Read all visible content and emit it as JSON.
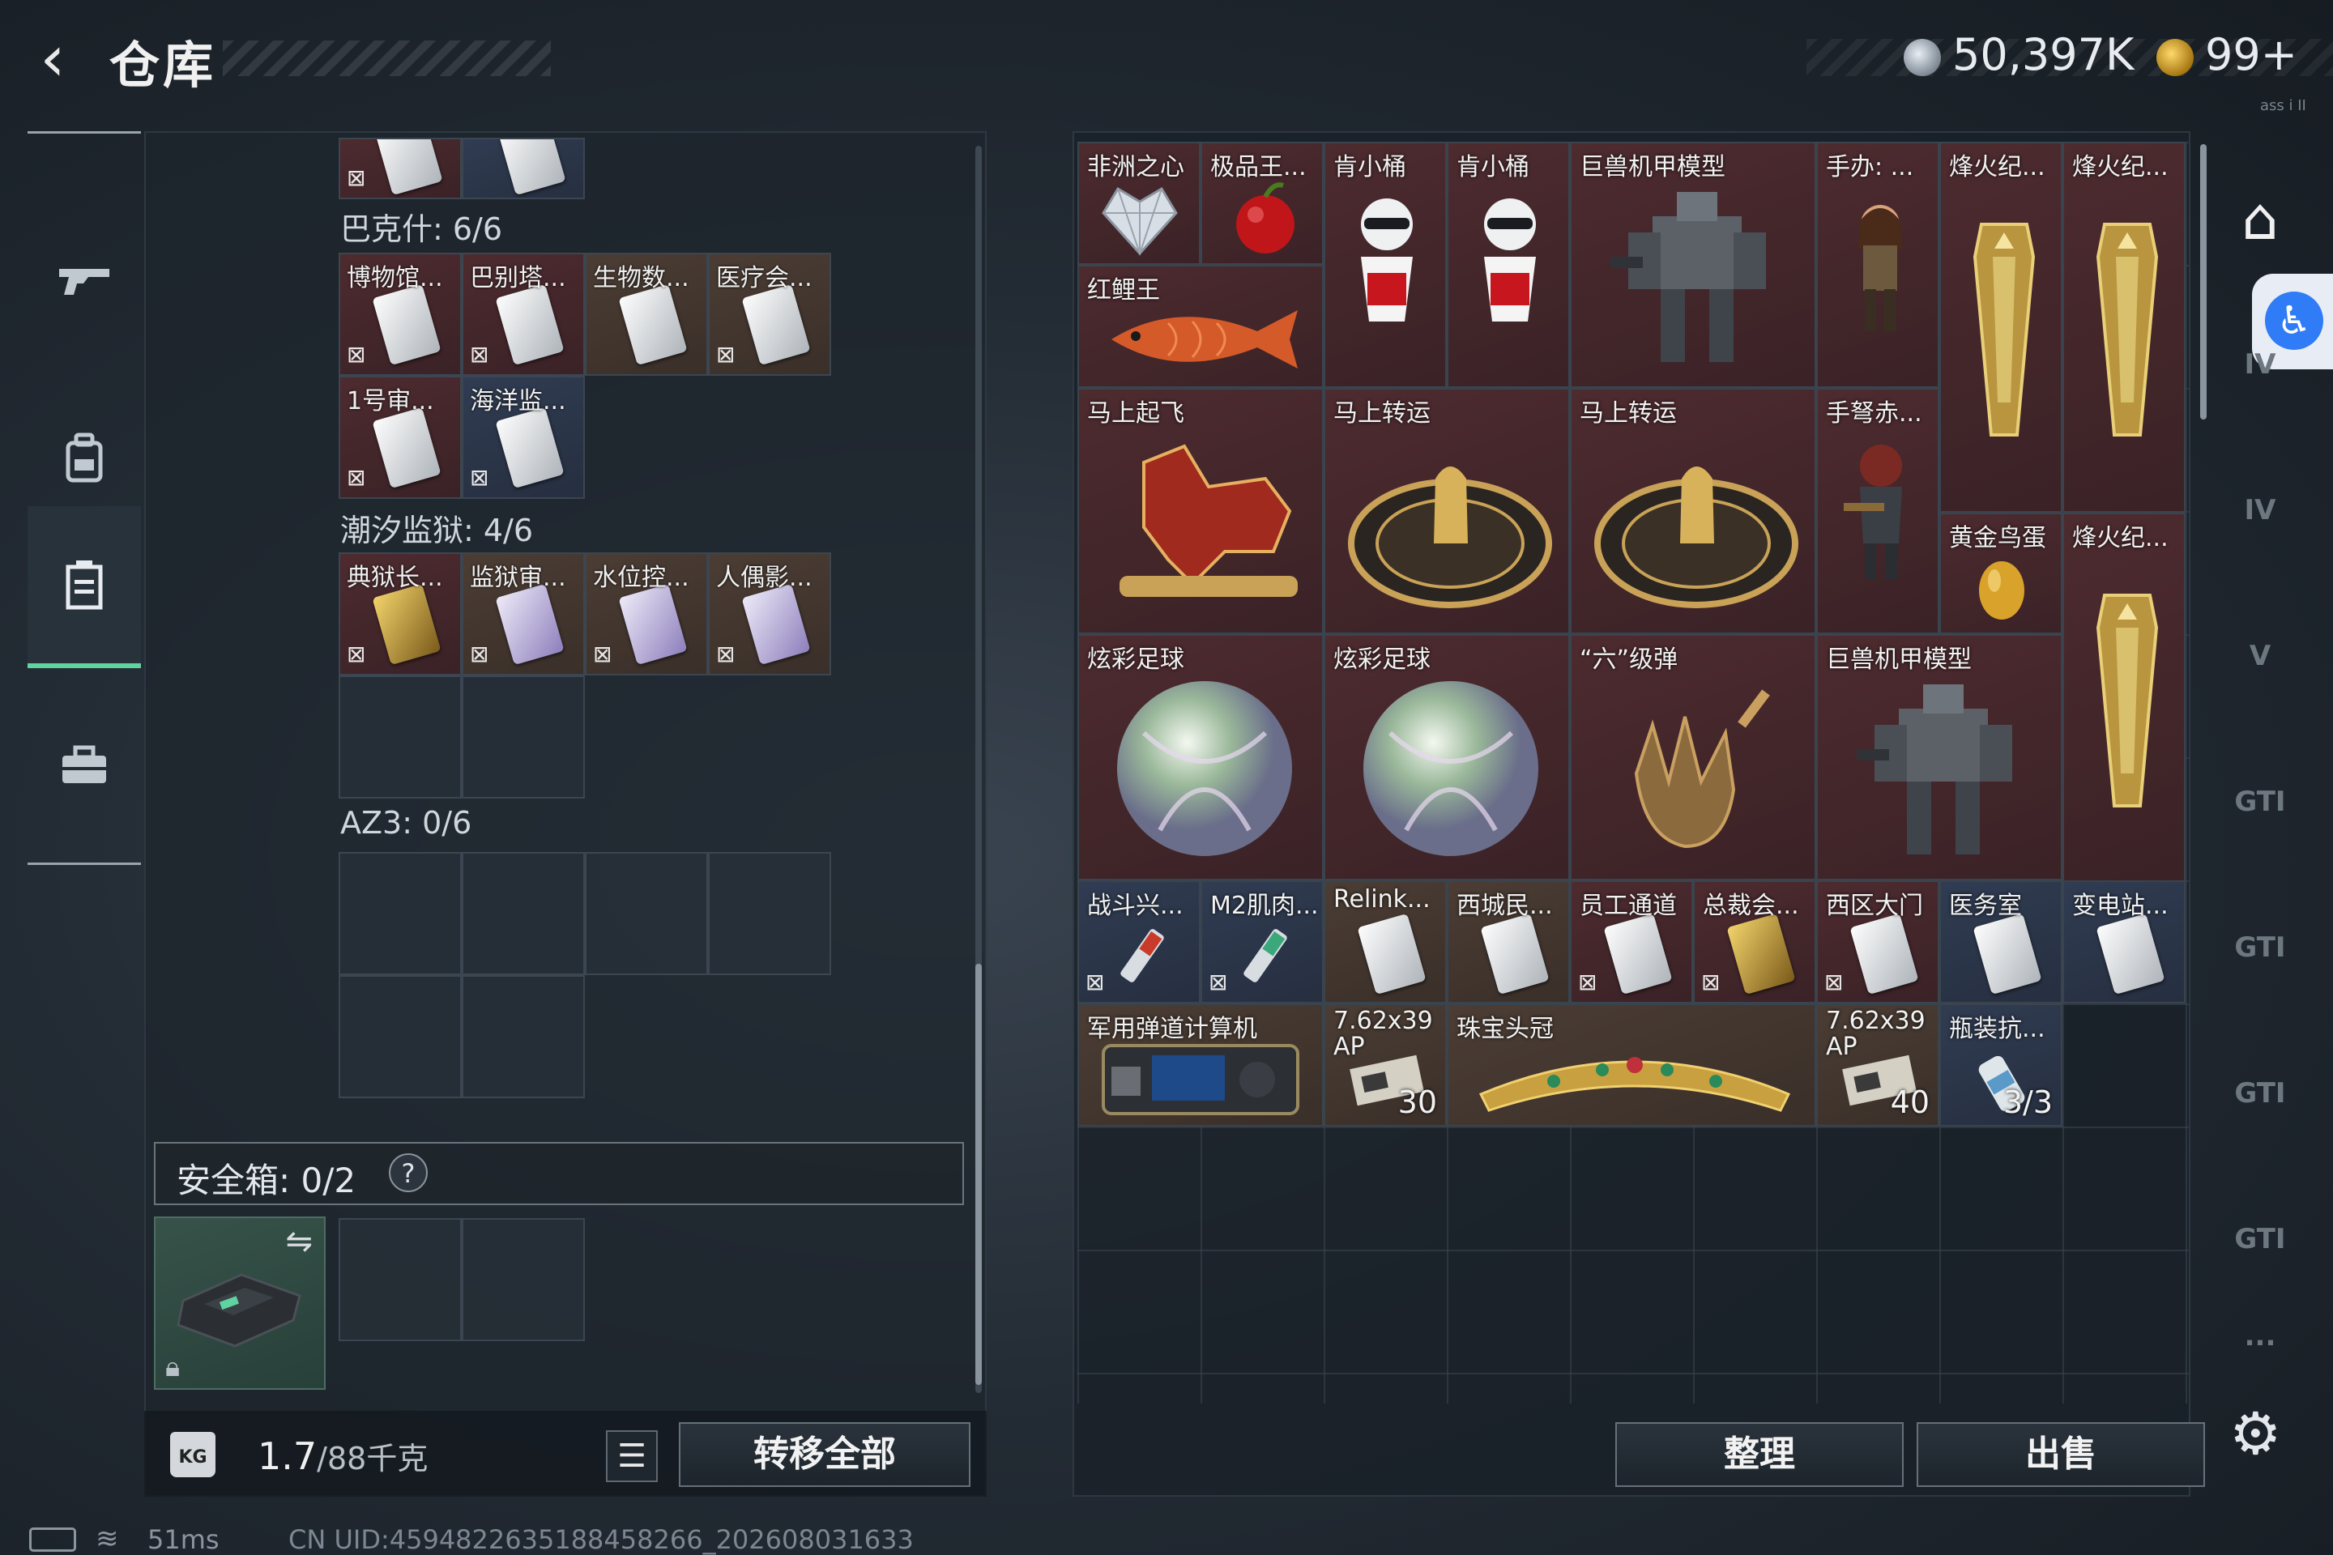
{
  "header": {
    "back_icon": "back-arrow-icon",
    "title": "仓库",
    "currency1": {
      "icon": "silver-coin-icon",
      "value": "50,397K"
    },
    "currency2": {
      "icon": "gold-coin-icon",
      "value": "99+"
    },
    "watermark": "ass i II"
  },
  "sidebar": {
    "items": [
      {
        "icon": "gun-icon",
        "glyph": "⌐"
      },
      {
        "icon": "backpack-icon",
        "glyph": "▣"
      },
      {
        "icon": "container-icon",
        "glyph": "▤",
        "active": true
      },
      {
        "icon": "briefcase-icon",
        "glyph": "■"
      }
    ]
  },
  "left": {
    "groups": [
      {
        "label": "巴克什: 6/6",
        "items": [
          "博物馆...",
          "巴别塔...",
          "生物数...",
          "医疗会...",
          "1号审...",
          "海洋监..."
        ]
      },
      {
        "label": "潮汐监狱: 4/6",
        "items": [
          "典狱长...",
          "监狱审...",
          "水位控...",
          "人偶影..."
        ]
      },
      {
        "label": "AZ3: 0/6",
        "items": []
      }
    ],
    "safe_box": {
      "label": "安全箱: 0/2",
      "help": "?"
    },
    "footer": {
      "weight": "1.7",
      "capacity": "/88千克",
      "kg_icon": "KG",
      "list_icon": "☰",
      "move_all": "转移全部"
    }
  },
  "right": {
    "items": [
      {
        "name": "非洲之心"
      },
      {
        "name": "极品王..."
      },
      {
        "name": "肯小桶"
      },
      {
        "name": "肯小桶"
      },
      {
        "name": "巨兽机甲模型"
      },
      {
        "name": "手办: ..."
      },
      {
        "name": "烽火纪..."
      },
      {
        "name": "烽火纪..."
      },
      {
        "name": "红鲤王"
      },
      {
        "name": "马上起飞"
      },
      {
        "name": "马上转运"
      },
      {
        "name": "马上转运"
      },
      {
        "name": "手弩赤..."
      },
      {
        "name": "黄金鸟蛋"
      },
      {
        "name": "烽火纪..."
      },
      {
        "name": "炫彩足球"
      },
      {
        "name": "炫彩足球"
      },
      {
        "name": "“六”级弹"
      },
      {
        "name": "巨兽机甲模型"
      },
      {
        "name": "战斗兴..."
      },
      {
        "name": "M2肌肉..."
      },
      {
        "name": "Relink..."
      },
      {
        "name": "西城民..."
      },
      {
        "name": "员工通道"
      },
      {
        "name": "总裁会..."
      },
      {
        "name": "西区大门"
      },
      {
        "name": "医务室"
      },
      {
        "name": "变电站..."
      },
      {
        "name": "军用弹道计算机"
      },
      {
        "name": "7.62x39 AP",
        "count": "30"
      },
      {
        "name": "珠宝头冠"
      },
      {
        "name": "7.62x39 AP",
        "count": "40"
      },
      {
        "name": "瓶装抗...",
        "count": "3/3"
      }
    ],
    "buttons": {
      "sort": "整理",
      "sell": "出售"
    }
  },
  "rail": {
    "home_icon": "storage-home-icon",
    "accessibility_icon": "accessibility-icon",
    "tabs": [
      "IV",
      "IV",
      "V",
      "GTI",
      "GTI",
      "GTI",
      "GTI",
      "..."
    ],
    "settings_icon": "gear-icon"
  },
  "status": {
    "ping": "51ms",
    "uid": "CN UID:4594822635188458266_202608031633"
  },
  "colors": {
    "accent": "#5fd3a0",
    "rare_red": "#4d2b2f",
    "rare_blue": "#303c52",
    "rare_tan": "#4b3d34"
  }
}
